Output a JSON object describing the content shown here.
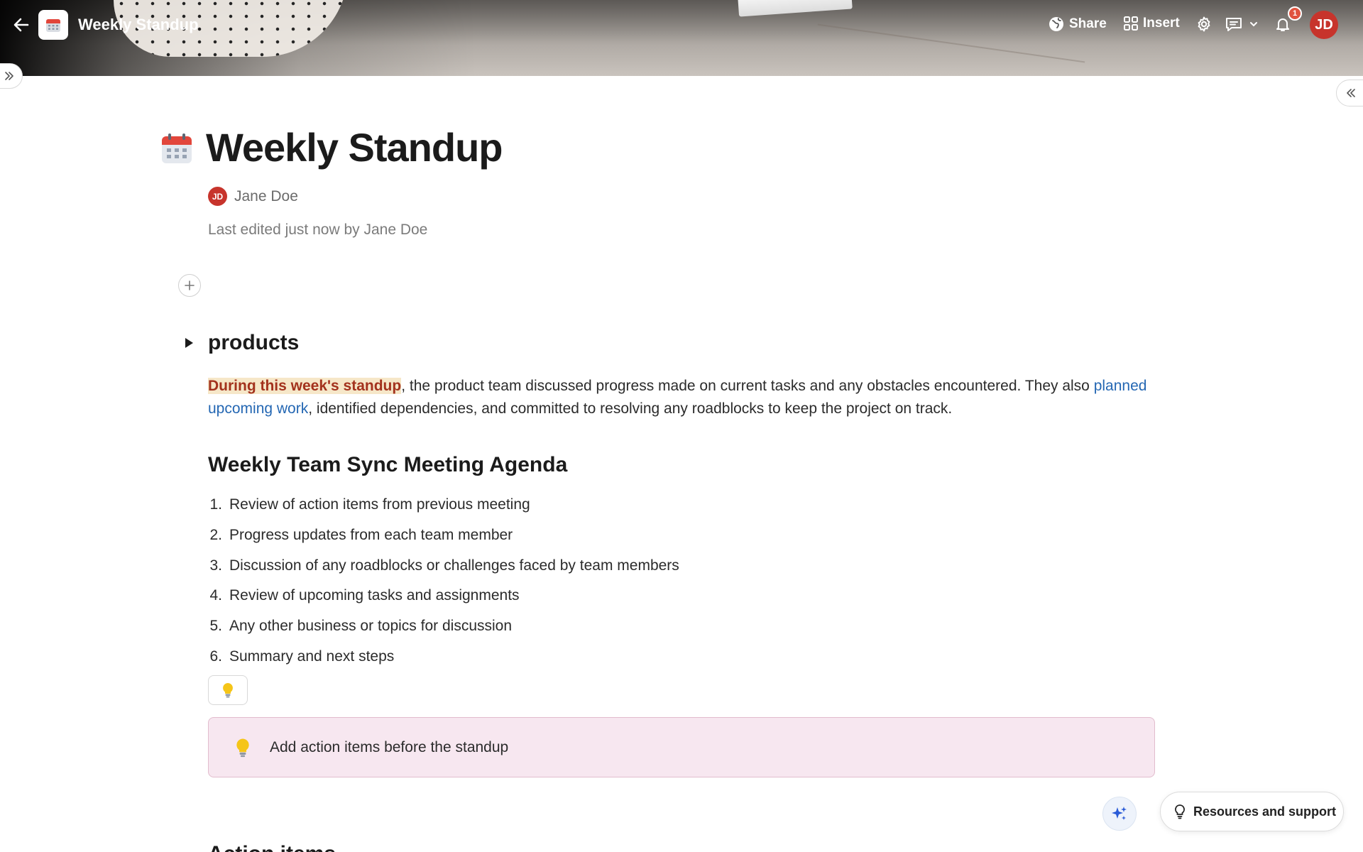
{
  "header": {
    "doc_title": "Weekly Standup",
    "share_label": "Share",
    "insert_label": "Insert",
    "notification_count": "1",
    "user_initials": "JD"
  },
  "doc": {
    "title": "Weekly Standup",
    "author_initials": "JD",
    "author_name": "Jane Doe",
    "last_edited": "Last edited just now by Jane Doe",
    "section_heading": "products",
    "paragraph": {
      "highlight": "During this week's standup",
      "part1": ", the product team discussed progress made on current tasks and any obstacles encountered. They also ",
      "link": "planned upcoming work",
      "part2": ", identified dependencies, and committed to resolving any roadblocks to keep the project on track."
    },
    "agenda_heading": "Weekly Team Sync Meeting Agenda",
    "agenda_items": [
      {
        "num": "1.",
        "text": "Review of action items from previous meeting"
      },
      {
        "num": "2.",
        "text": "Progress updates from each team member"
      },
      {
        "num": "3.",
        "text": "Discussion of any roadblocks or challenges faced by team members"
      },
      {
        "num": "4.",
        "text": "Review of upcoming tasks and assignments"
      },
      {
        "num": "5.",
        "text": "Any other business or topics for discussion"
      },
      {
        "num": "6.",
        "text": "Summary and next steps"
      }
    ],
    "callout_text": "Add action items before the standup",
    "next_heading": "Action items"
  },
  "footer": {
    "resources_label": "Resources and support"
  },
  "colors": {
    "avatar": "#c7342c",
    "highlight_text": "#a3321d",
    "highlight_bg": "#f6e7c8",
    "link": "#2467b3",
    "callout_bg": "#f7e7f0"
  }
}
